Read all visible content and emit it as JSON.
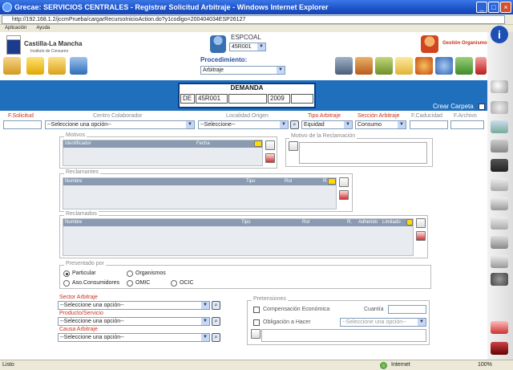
{
  "window": {
    "title": "Grecae: SERVICIOS CENTRALES - Registrar Solicitud Arbitraje - Windows Internet Explorer"
  },
  "browser": {
    "url": "http://192.168.1.2/jccmPrueba/cargarRecursoInicioAction.do?y1codigo=200404034ESP26127",
    "menu": [
      "Aplicación",
      "Ayuda"
    ]
  },
  "header": {
    "logo_title": "Castilla-La Mancha",
    "logo_subtitle": "Instituto de Consumo",
    "user_label": "ESPCOAL",
    "user_value": "45R001",
    "procedimiento_label": "Procedimiento:",
    "procedimiento_value": "Arbitraje",
    "gestion_label": "Gestión Organismo"
  },
  "demanda": {
    "title": "DEMANDA",
    "prefix": "DE",
    "code": "45R001",
    "blank1": "",
    "year": "2009",
    "blank2": ""
  },
  "crear_carpeta": "Crear Carpeta",
  "filters": {
    "f_solicitud": "F.Solicitud",
    "centro_colaborador": "Centro Colaborador",
    "centro_value": "--Seleccione una opción--",
    "localidad_origen": "Localidad Origen",
    "localidad_value": "--Seleccione--",
    "tipo_arbitraje": "Tipo Arbitraje",
    "tipo_value": "Equidad",
    "seccion_arbitraje": "Sección Arbitraje",
    "seccion_value": "Consumo",
    "f_caducidad": "F.Caducidad",
    "f_archivo": "F.Archivo"
  },
  "motivos": {
    "legend": "Motivos",
    "columns": [
      "Identificador",
      "Fecha"
    ]
  },
  "motivo_reclamacion": {
    "legend": "Motivo de la Reclamación"
  },
  "reclamantes": {
    "legend": "Reclamantes",
    "columns": [
      "Nombre",
      "Tipo",
      "Rol",
      "R."
    ]
  },
  "reclamados": {
    "legend": "Reclamados",
    "columns": [
      "Nombre",
      "Tipo",
      "Rol",
      "R.",
      "Adherido",
      "Limitado"
    ]
  },
  "presentado": {
    "legend": "Presentado por",
    "options": [
      "Particular",
      "Organismos",
      "Aso.Consumidores",
      "OMIC",
      "OCIC"
    ],
    "selected": "Particular"
  },
  "sector": {
    "sector_label": "Sector Arbitraje",
    "sector_value": "--Seleccione una opción--",
    "producto_label": "Producto/Servicio",
    "producto_value": "--Seleccione una opción--",
    "causa_label": "Causa Arbitraje",
    "causa_value": "--Seleccione una opción--"
  },
  "pretensiones": {
    "legend": "Pretensiones",
    "compensacion": "Compensación Económica",
    "cuantia": "Cuantía",
    "obligacion": "Obligación a Hacer",
    "obligacion_value": "--Seleccione una opción--"
  },
  "status": {
    "left": "Listo",
    "zone": "Internet",
    "zoom": "100%"
  },
  "colors": {
    "accent_blue": "#1f6fbd",
    "label_red": "#c9331f",
    "title_blue": "#1c52c9"
  }
}
